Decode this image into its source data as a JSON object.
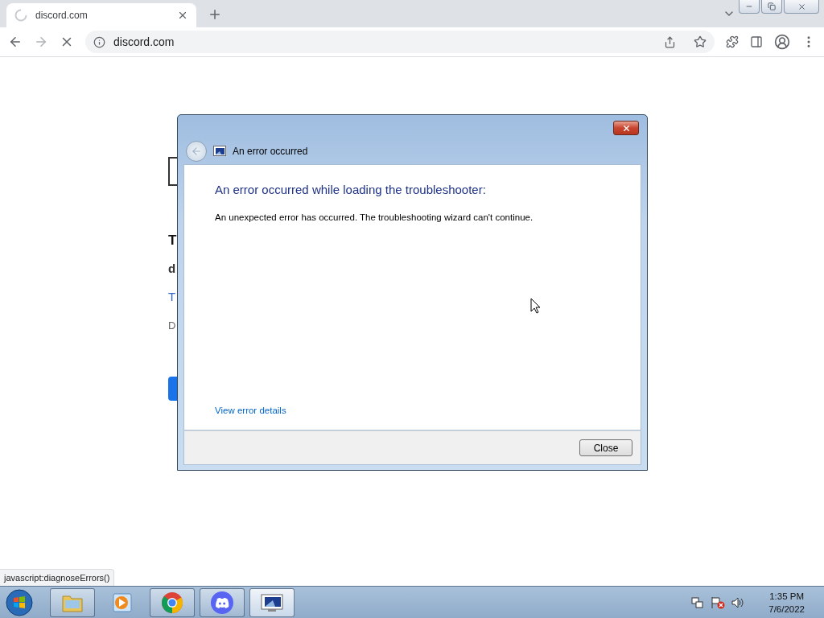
{
  "browser": {
    "tabs": [
      {
        "title": "discord.com",
        "selected": true,
        "loading": true
      }
    ],
    "toolbar": {
      "forward_disabled": true,
      "loading": true
    },
    "address": {
      "value": "discord.com"
    }
  },
  "page_fragments": [
    {
      "kind": "heading",
      "text": "T"
    },
    {
      "kind": "subheading",
      "text": "d"
    },
    {
      "kind": "link",
      "text": "T"
    },
    {
      "kind": "caption",
      "text": "D"
    }
  ],
  "dialog": {
    "title": "An error occurred",
    "heading": "An error occurred while loading the troubleshooter:",
    "message": "An unexpected error has occurred. The troubleshooting wizard can't continue.",
    "link": "View error details",
    "buttons": [
      "Close"
    ]
  },
  "status_bubble": "javascript:diagnoseErrors()",
  "taskbar": {
    "items": [
      {
        "kind": "folder",
        "running": true,
        "active": false
      },
      {
        "kind": "media",
        "running": false,
        "active": false
      },
      {
        "kind": "chrome",
        "running": true,
        "active": false
      },
      {
        "kind": "discord",
        "running": true,
        "active": false
      },
      {
        "kind": "troubleshooter",
        "running": true,
        "active": true
      }
    ],
    "clock": {
      "time": "1:35 PM",
      "date": "7/6/2022"
    }
  }
}
